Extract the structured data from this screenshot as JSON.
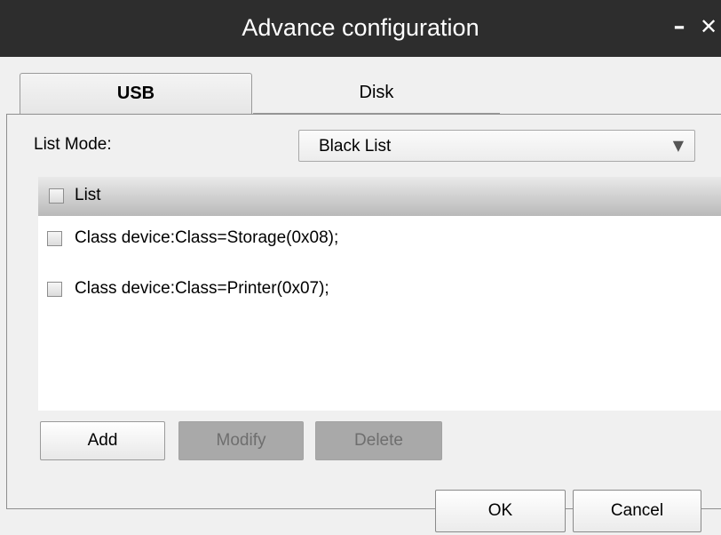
{
  "window": {
    "title": "Advance configuration",
    "minimize_glyph": "–",
    "close_glyph": "✕"
  },
  "tabs": [
    {
      "label": "USB",
      "active": true
    },
    {
      "label": "Disk",
      "active": false
    }
  ],
  "list_mode": {
    "label": "List Mode:",
    "selected_value": "Black List",
    "arrow_glyph": "▼"
  },
  "list": {
    "header_label": "List",
    "header_checked": false,
    "items": [
      {
        "label": "Class device:Class=Storage(0x08);",
        "checked": false
      },
      {
        "label": "Class device:Class=Printer(0x07);",
        "checked": false
      }
    ]
  },
  "actions": {
    "add_label": "Add",
    "modify_label": "Modify",
    "modify_enabled": false,
    "delete_label": "Delete",
    "delete_enabled": false
  },
  "footer": {
    "ok_label": "OK",
    "cancel_label": "Cancel"
  },
  "colors": {
    "titlebar": "#2d2d2d",
    "disabled_button": "#a9a9a9",
    "list_header": "#c4c4c4"
  }
}
